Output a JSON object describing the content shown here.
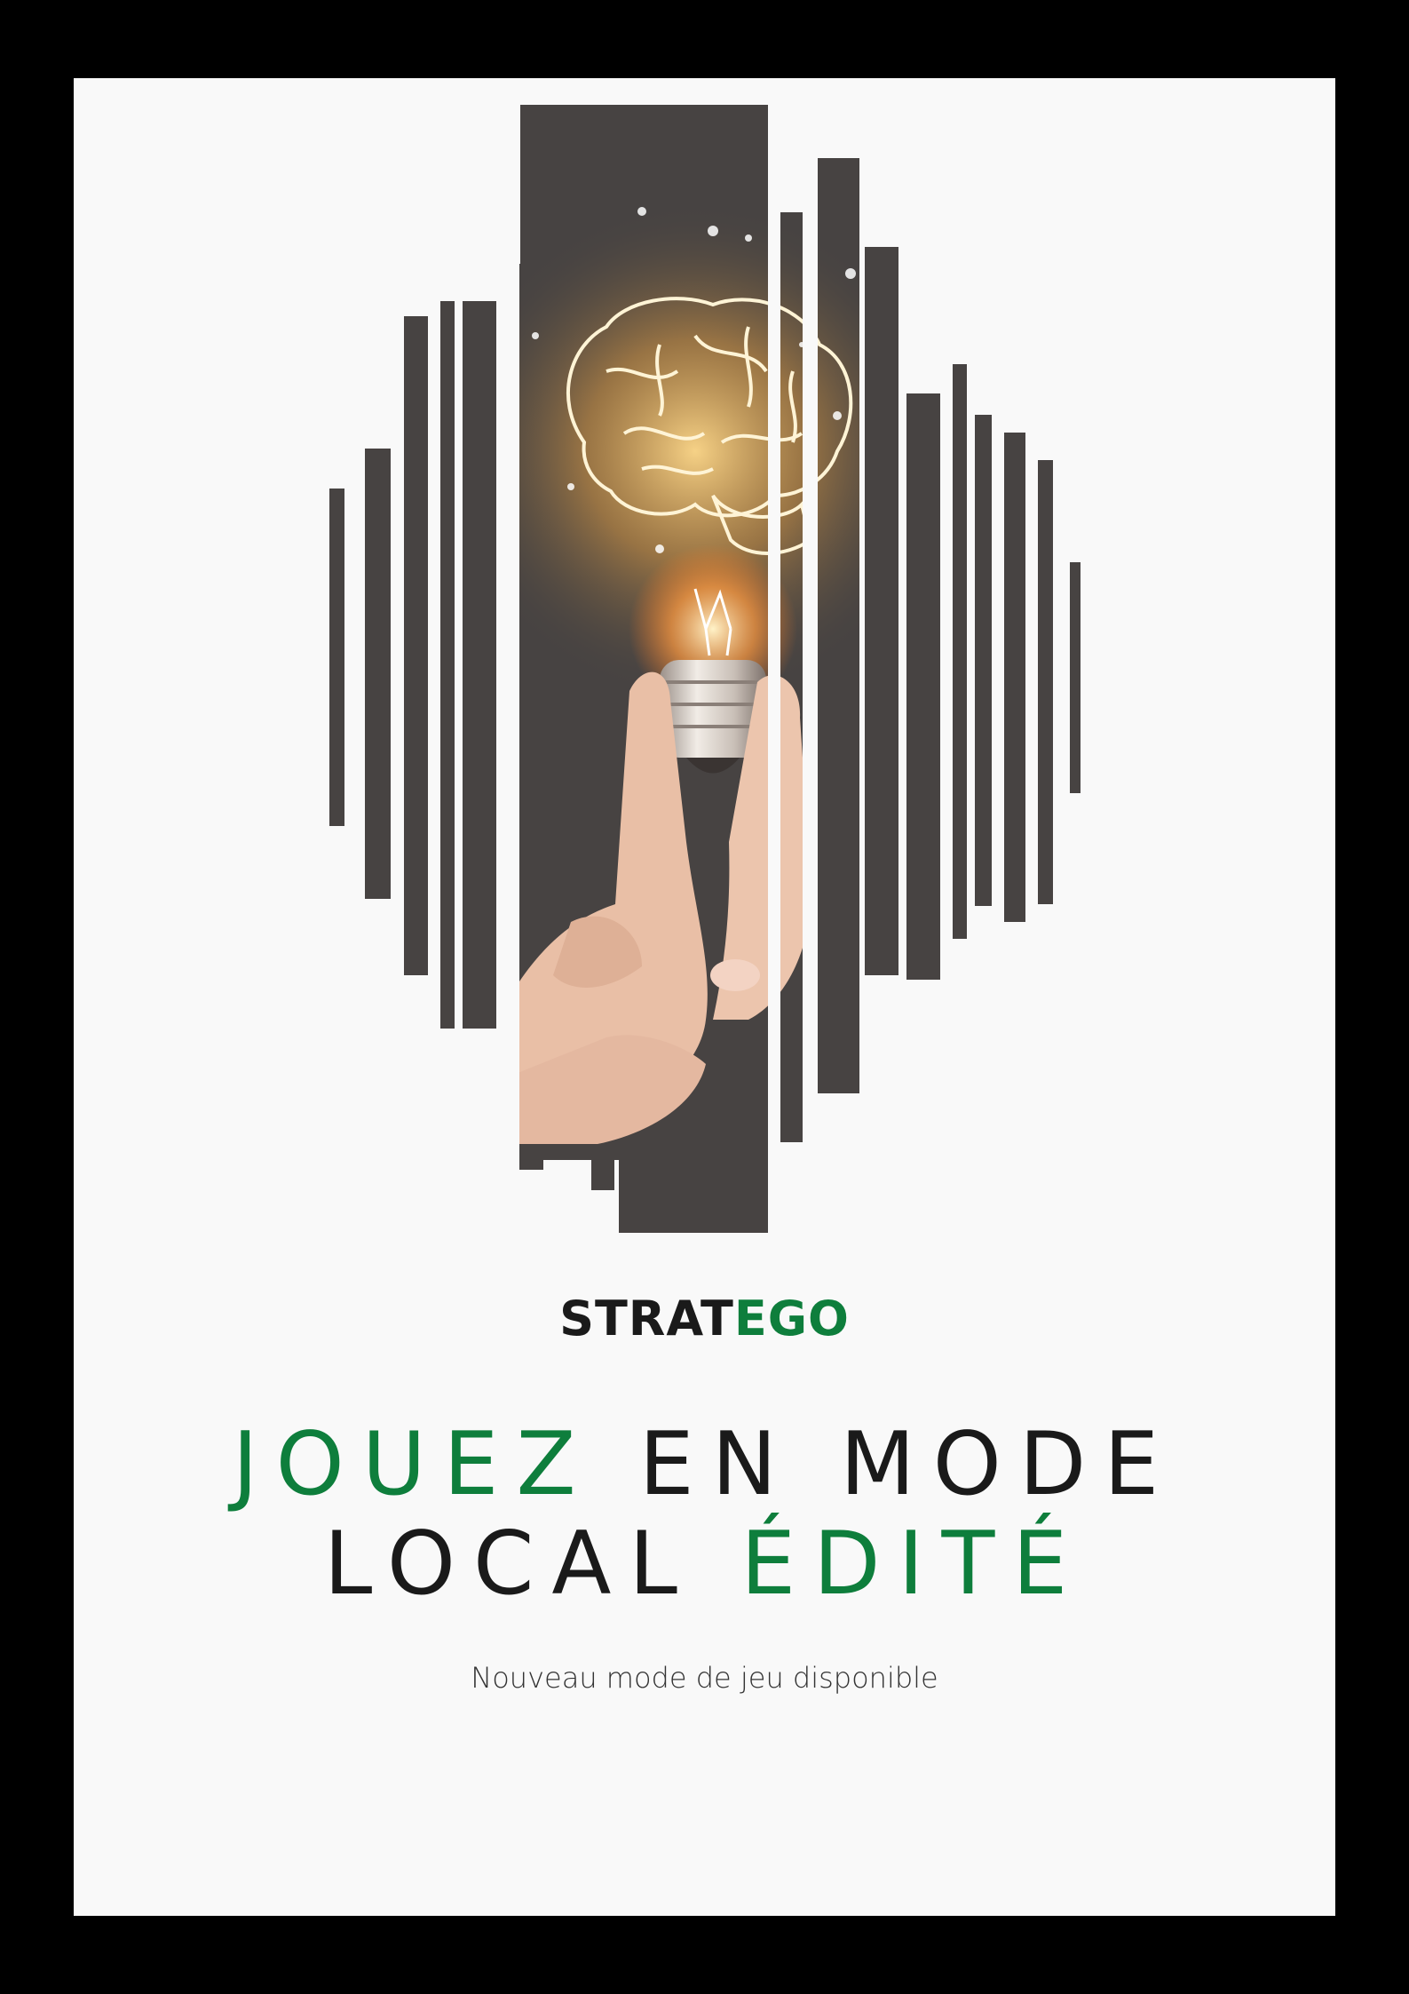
{
  "brand": {
    "part1": "STRAT",
    "part2": "EGO"
  },
  "headline": {
    "line1_word1": "JOUEZ",
    "line1_rest": " EN MODE",
    "line2_word1": "LOCAL ",
    "line2_word2": "ÉDITÉ"
  },
  "subtitle": "Nouveau mode de jeu disponible",
  "colors": {
    "background": "#000000",
    "poster": "#f9f9f9",
    "green": "#0e7e3c",
    "dark_text": "#1a1a1a",
    "bar": "#474342"
  },
  "illustration": {
    "icons": [
      "brain-icon",
      "light-bulb-icon",
      "hand-icon"
    ]
  }
}
